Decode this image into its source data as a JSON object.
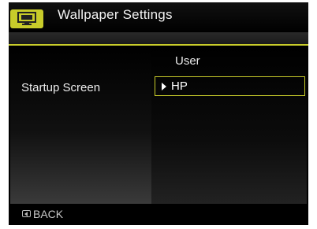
{
  "header": {
    "title": "Wallpaper Settings",
    "icon": "monitor-icon",
    "accent_color": "#c8cc2a"
  },
  "column_header": "User",
  "settings": [
    {
      "label": "Startup Screen",
      "value": "HP",
      "selected": true
    }
  ],
  "footer": {
    "back_label": "BACK",
    "back_icon": "back-arrow-icon"
  }
}
